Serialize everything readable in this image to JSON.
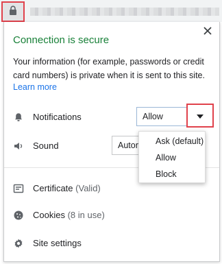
{
  "popup": {
    "title": "Connection is secure",
    "description": "Your information (for example, passwords or credit card numbers) is private when it is sent to this site.",
    "learn_more": "Learn more"
  },
  "permissions": {
    "notifications": {
      "label": "Notifications",
      "value": "Allow",
      "options": [
        "Ask (default)",
        "Allow",
        "Block"
      ]
    },
    "sound": {
      "label": "Sound",
      "value": "Autor"
    }
  },
  "links": {
    "certificate": {
      "label": "Certificate",
      "detail": "(Valid)"
    },
    "cookies": {
      "label": "Cookies",
      "detail": "(8 in use)"
    },
    "site_settings": {
      "label": "Site settings"
    }
  },
  "colors": {
    "secure_green": "#188038",
    "link_blue": "#1a73e8",
    "highlight_red": "#e0414b"
  },
  "icons": [
    "lock-icon",
    "close-icon",
    "bell-icon",
    "speaker-icon",
    "chevron-down-icon",
    "certificate-icon",
    "cookie-icon",
    "gear-icon"
  ]
}
